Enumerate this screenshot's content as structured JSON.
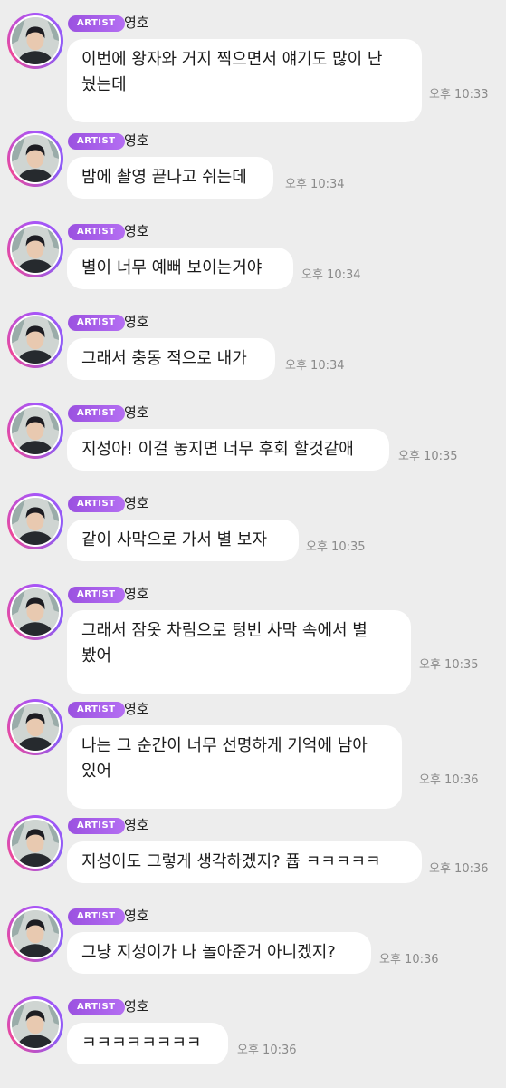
{
  "sender": {
    "badge": "ARTIST",
    "name": "영호"
  },
  "messages": [
    {
      "text": "이번에 왕자와 거지 찍으면서 얘기도 많이 난\n눴는데",
      "time": "오후 10:33"
    },
    {
      "text": "밤에 촬영 끝나고 쉬는데",
      "time": "오후 10:34"
    },
    {
      "text": "별이 너무 예뻐 보이는거야",
      "time": "오후 10:34"
    },
    {
      "text": "그래서 충동 적으로 내가",
      "time": "오후 10:34"
    },
    {
      "text": "지성아! 이걸 놓지면 너무 후회 할것같애",
      "time": "오후 10:35"
    },
    {
      "text": "같이 사막으로 가서 별 보자",
      "time": "오후 10:35"
    },
    {
      "text": "그래서 잠옷 차림으로 텅빈 사막 속에서 별\n봤어",
      "time": "오후 10:35"
    },
    {
      "text": "나는 그 순간이 너무 선명하게 기억에 남아\n있어",
      "time": "오후 10:36"
    },
    {
      "text": "지성이도 그렇게 생각하겠지? 퓹 ㅋㅋㅋㅋㅋ",
      "time": "오후 10:36"
    },
    {
      "text": "그냥 지성이가 나 놀아준거 아니겠지?",
      "time": "오후 10:36"
    },
    {
      "text": "ㅋㅋㅋㅋㅋㅋㅋㅋ",
      "time": "오후 10:36"
    }
  ]
}
